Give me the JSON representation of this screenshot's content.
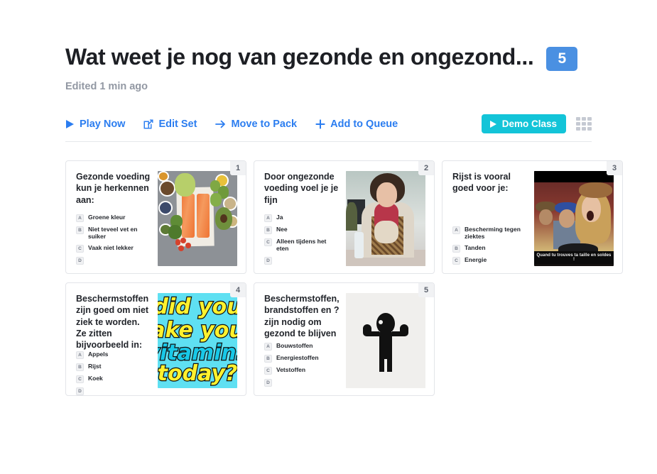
{
  "header": {
    "title": "Wat weet je nog van gezonde en ongezond...",
    "count": "5",
    "edited": "Edited 1 min ago"
  },
  "toolbar": {
    "play_now": "Play Now",
    "edit_set": "Edit Set",
    "move_to_pack": "Move to Pack",
    "add_to_queue": "Add to Queue",
    "demo_class": "Demo Class",
    "icons": {
      "play": "play-icon",
      "edit": "edit-square-icon",
      "arrow": "arrow-right-icon",
      "plus": "plus-icon",
      "grid": "grid-view-icon"
    },
    "accent_blue": "#2b7df0",
    "demo_teal": "#13c4d8"
  },
  "cards": [
    {
      "number": "1",
      "question": "Gezonde voeding kun je herkennen aan:",
      "answers": [
        {
          "letter": "A",
          "text": "Groene kleur"
        },
        {
          "letter": "B",
          "text": "Niet teveel vet en suiker"
        },
        {
          "letter": "C",
          "text": "Vaak niet lekker"
        },
        {
          "letter": "D",
          "text": ""
        }
      ],
      "media": "healthy-food-photo"
    },
    {
      "number": "2",
      "question": "Door ongezonde voeding voel je je fijn",
      "answers": [
        {
          "letter": "A",
          "text": "Ja"
        },
        {
          "letter": "B",
          "text": "Nee"
        },
        {
          "letter": "C",
          "text": "Alleen tijdens het eten"
        },
        {
          "letter": "D",
          "text": ""
        }
      ],
      "media": "office-woman-photo"
    },
    {
      "number": "3",
      "question": "Rijst is vooral goed voor je:",
      "answers": [
        {
          "letter": "A",
          "text": "Bescherming tegen ziektes"
        },
        {
          "letter": "B",
          "text": "Tanden"
        },
        {
          "letter": "C",
          "text": "Energie"
        }
      ],
      "media": "meme-photo",
      "media_caption": "Quand tu trouves ta taille en soldes !"
    },
    {
      "number": "4",
      "question": "Beschermstoffen zijn goed om niet ziek te worden. Ze zitten bijvoorbeeld in:",
      "answers": [
        {
          "letter": "A",
          "text": "Appels"
        },
        {
          "letter": "B",
          "text": "Rijst"
        },
        {
          "letter": "C",
          "text": "Koek"
        },
        {
          "letter": "D",
          "text": ""
        }
      ],
      "media": "vitamins-graphic",
      "media_lines": [
        "did you",
        "ake you",
        "vitamins",
        "today?"
      ]
    },
    {
      "number": "5",
      "question": "Beschermstoffen, brandstoffen en ? zijn nodig om gezond te blijven",
      "answers": [
        {
          "letter": "A",
          "text": "Bouwstoffen"
        },
        {
          "letter": "B",
          "text": "Energiestoffen"
        },
        {
          "letter": "C",
          "text": "Vetstoffen"
        },
        {
          "letter": "D",
          "text": ""
        }
      ],
      "media": "strongman-icon"
    }
  ]
}
